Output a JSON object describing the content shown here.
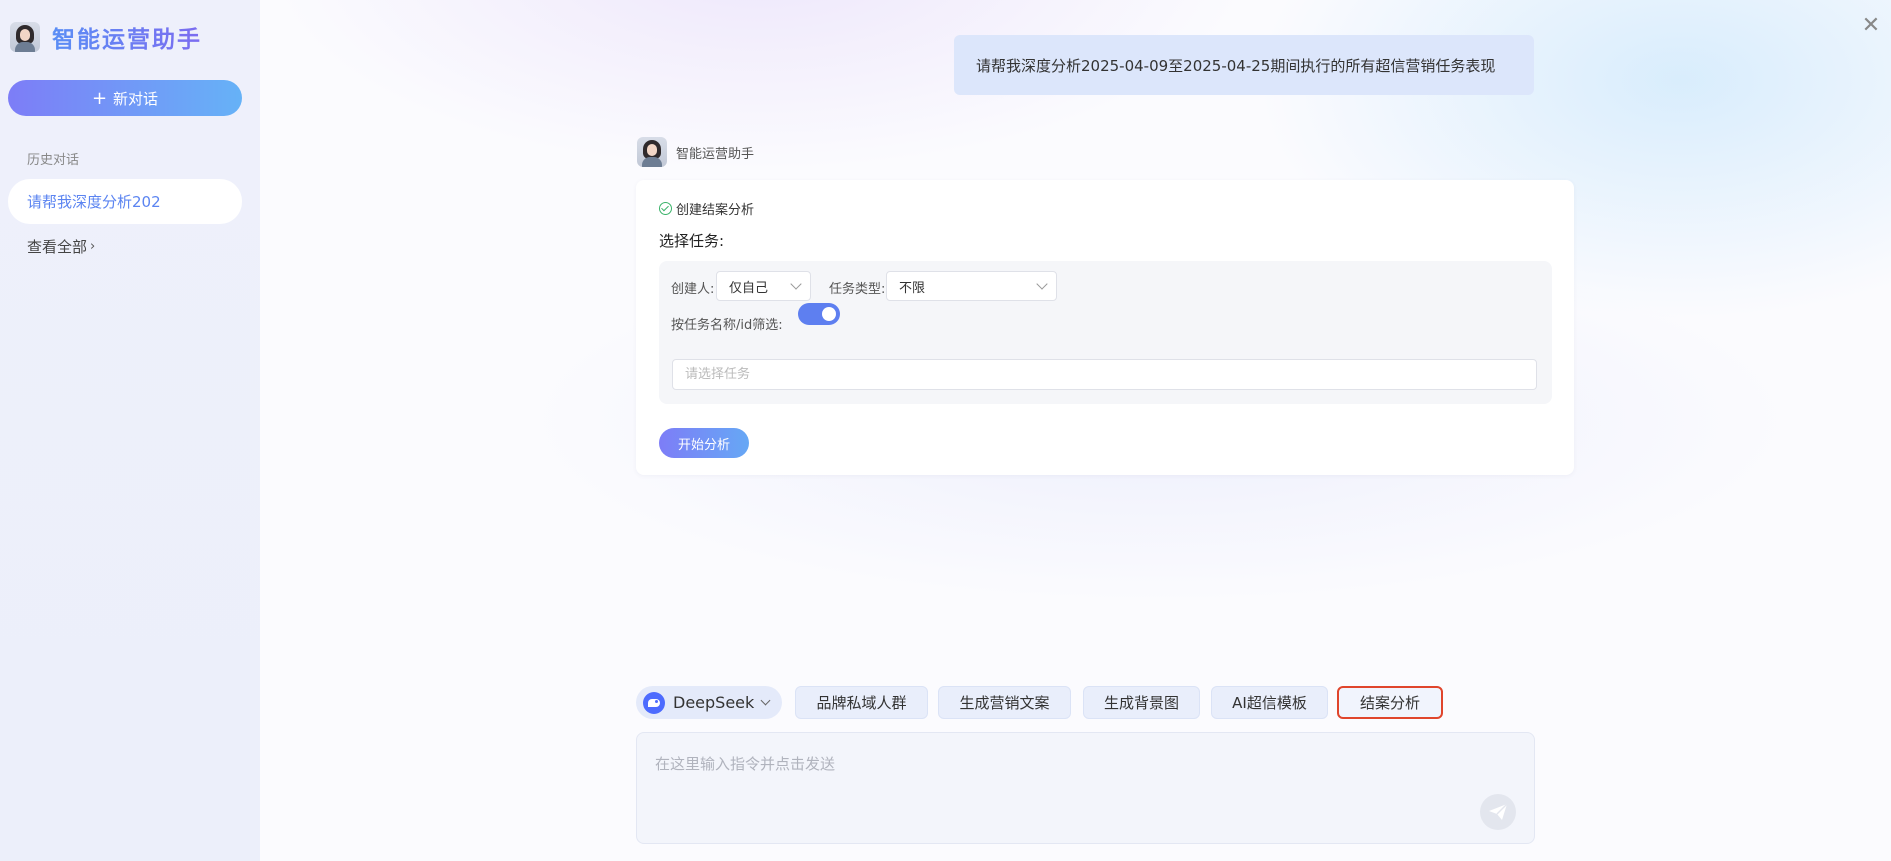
{
  "sidebar": {
    "brand_title": "智能运营助手",
    "new_chat_label": "新对话",
    "history_label": "历史对话",
    "history_items": [
      {
        "label": "请帮我深度分析202"
      }
    ],
    "view_all_label": "查看全部"
  },
  "chat": {
    "user_message": "请帮我深度分析2025-04-09至2025-04-25期间执行的所有超信营销任务表现",
    "bot_name": "智能运营助手",
    "card": {
      "status_text": "创建结案分析",
      "select_title": "选择任务:",
      "creator_label": "创建人:",
      "creator_value": "仅自己",
      "task_type_label": "任务类型:",
      "task_type_value": "不限",
      "filter_by_name_label": "按任务名称/id筛选:",
      "filter_toggle_on": true,
      "task_placeholder": "请选择任务",
      "start_button": "开始分析"
    }
  },
  "toolbar": {
    "model_name": "DeepSeek",
    "chips": [
      {
        "label": "品牌私域人群"
      },
      {
        "label": "生成营销文案"
      },
      {
        "label": "生成背景图"
      },
      {
        "label": "AI超信模板"
      },
      {
        "label": "结案分析",
        "active": true
      }
    ]
  },
  "prompt": {
    "placeholder": "在这里输入指令并点击发送"
  },
  "icons": {
    "brand": "assistant-avatar-icon",
    "close": "close-icon",
    "status": "check-circle-icon",
    "model": "deepseek-logo-icon",
    "send": "send-icon"
  },
  "colors": {
    "accent": "#5e7ff0",
    "active_chip_border": "#e0452c",
    "user_bubble": "#dce6fb"
  }
}
